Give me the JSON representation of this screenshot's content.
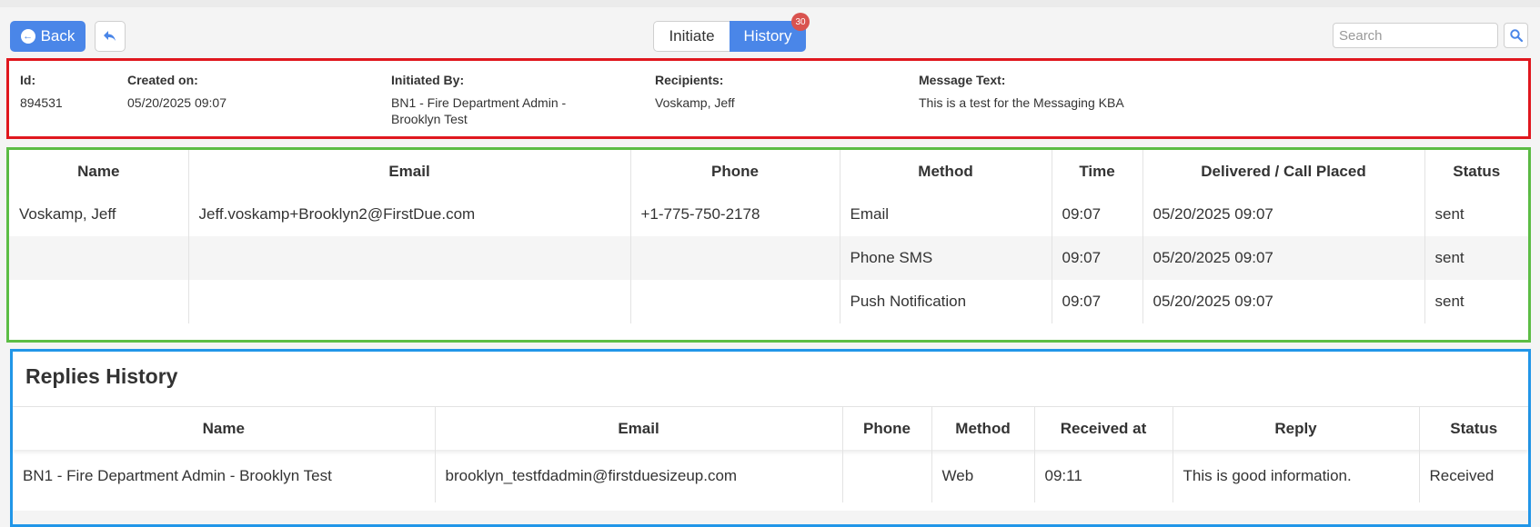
{
  "toolbar": {
    "back_label": "Back",
    "tabs": [
      {
        "label": "Initiate",
        "active": false
      },
      {
        "label": "History",
        "active": true,
        "badge": "30"
      }
    ],
    "search_placeholder": "Search"
  },
  "message_info": {
    "id_label": "Id:",
    "id_value": "894531",
    "created_label": "Created on:",
    "created_value": "05/20/2025 09:07",
    "initiated_label": "Initiated By:",
    "initiated_value": "BN1 - Fire Department Admin - Brooklyn Test",
    "recipients_label": "Recipients:",
    "recipients_value": "Voskamp, Jeff",
    "text_label": "Message Text:",
    "text_value": "This is a test for the Messaging KBA"
  },
  "delivery_table": {
    "headers": [
      "Name",
      "Email",
      "Phone",
      "Method",
      "Time",
      "Delivered / Call Placed",
      "Status"
    ],
    "rows": [
      [
        "Voskamp, Jeff",
        "Jeff.voskamp+Brooklyn2@FirstDue.com",
        "+1-775-750-2178",
        "Email",
        "09:07",
        "05/20/2025 09:07",
        "sent"
      ],
      [
        "",
        "",
        "",
        "Phone SMS",
        "09:07",
        "05/20/2025 09:07",
        "sent"
      ],
      [
        "",
        "",
        "",
        "Push Notification",
        "09:07",
        "05/20/2025 09:07",
        "sent"
      ]
    ]
  },
  "replies": {
    "title": "Replies History",
    "headers": [
      "Name",
      "Email",
      "Phone",
      "Method",
      "Received at",
      "Reply",
      "Status"
    ],
    "rows": [
      [
        "BN1 - Fire Department Admin - Brooklyn Test",
        "brooklyn_testfdadmin@firstduesizeup.com",
        "",
        "Web",
        "09:11",
        "This is good information.",
        "Received"
      ]
    ]
  },
  "colors": {
    "primary": "#4a86e8",
    "badge": "#d9534f",
    "highlight_red": "#e0171e",
    "highlight_green": "#5cbd45",
    "highlight_blue": "#2196e8"
  }
}
